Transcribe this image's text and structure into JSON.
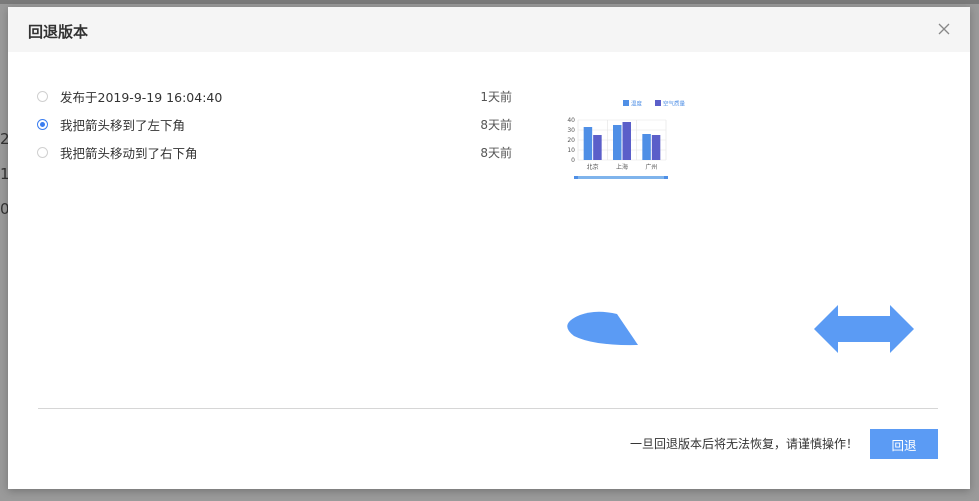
{
  "background": {
    "partial_chars": [
      "2",
      "1",
      "0"
    ]
  },
  "modal": {
    "title": "回退版本",
    "close_icon": "close-icon",
    "versions": [
      {
        "label": "发布于2019-9-19 16:04:40",
        "time": "1天前",
        "selected": false
      },
      {
        "label": "我把箭头移到了左下角",
        "time": "8天前",
        "selected": true
      },
      {
        "label": "我把箭头移动到了右下角",
        "time": "8天前",
        "selected": false
      }
    ],
    "warning": "一旦回退版本后将无法恢复，请谨慎操作！",
    "rollback_label": "回退"
  },
  "colors": {
    "accent": "#3a7df0",
    "button": "#5b9bf4",
    "series_1": "#4f8fe6",
    "series_2": "#5b5fc9",
    "shape": "#5b9bf4"
  },
  "chart_data": {
    "type": "bar",
    "categories": [
      "北京",
      "上海",
      "广州"
    ],
    "series": [
      {
        "name": "温度",
        "values": [
          33,
          35,
          26
        ]
      },
      {
        "name": "空气质量",
        "values": [
          25,
          38,
          25
        ]
      }
    ],
    "yticks": [
      0,
      10,
      20,
      30,
      40
    ],
    "ylim": [
      0,
      40
    ],
    "legend": "top",
    "grid": true
  }
}
